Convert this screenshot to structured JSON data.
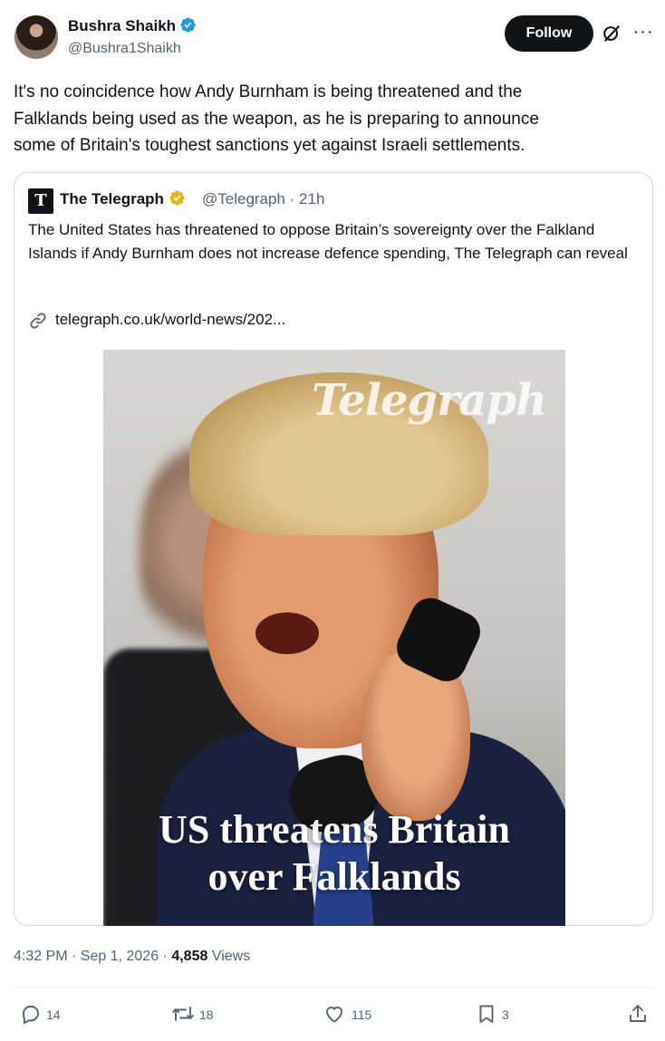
{
  "author": {
    "name": "Bushra Shaikh",
    "handle": "@Bushra1Shaikh",
    "verified_color": "#1d9bf0"
  },
  "header": {
    "follow_label": "Follow",
    "grok_icon": "grok-icon",
    "more_icon": "more-icon",
    "more_glyph": "···"
  },
  "tweet": {
    "text": "It's no coincidence how Andy Burnham is being threatened and the\nFalklands being used as the weapon, as he is preparing to announce\nsome of Britain's toughest sanctions yet against Israeli settlements."
  },
  "quote": {
    "logo_glyph": "T",
    "name": "The Telegraph",
    "verified_color": "#e2b719",
    "handle_time": "@Telegraph · 21h",
    "text": "The United States has threatened to oppose Britain’s sovereignty over the Falkland Islands if Andy Burnham does not increase defence spending, The Telegraph can reveal",
    "link": "telegraph.co.uk/world-news/202...",
    "image": {
      "watermark": "Telegraph",
      "headline": "US threatens Britain\nover Falklands"
    }
  },
  "meta": {
    "time": "4:32 PM · Sep 1, 2026 · ",
    "views_count": "4,858",
    "views_label": " Views"
  },
  "actions": {
    "replies": "14",
    "reposts": "18",
    "likes": "115",
    "bookmarks": "3"
  }
}
